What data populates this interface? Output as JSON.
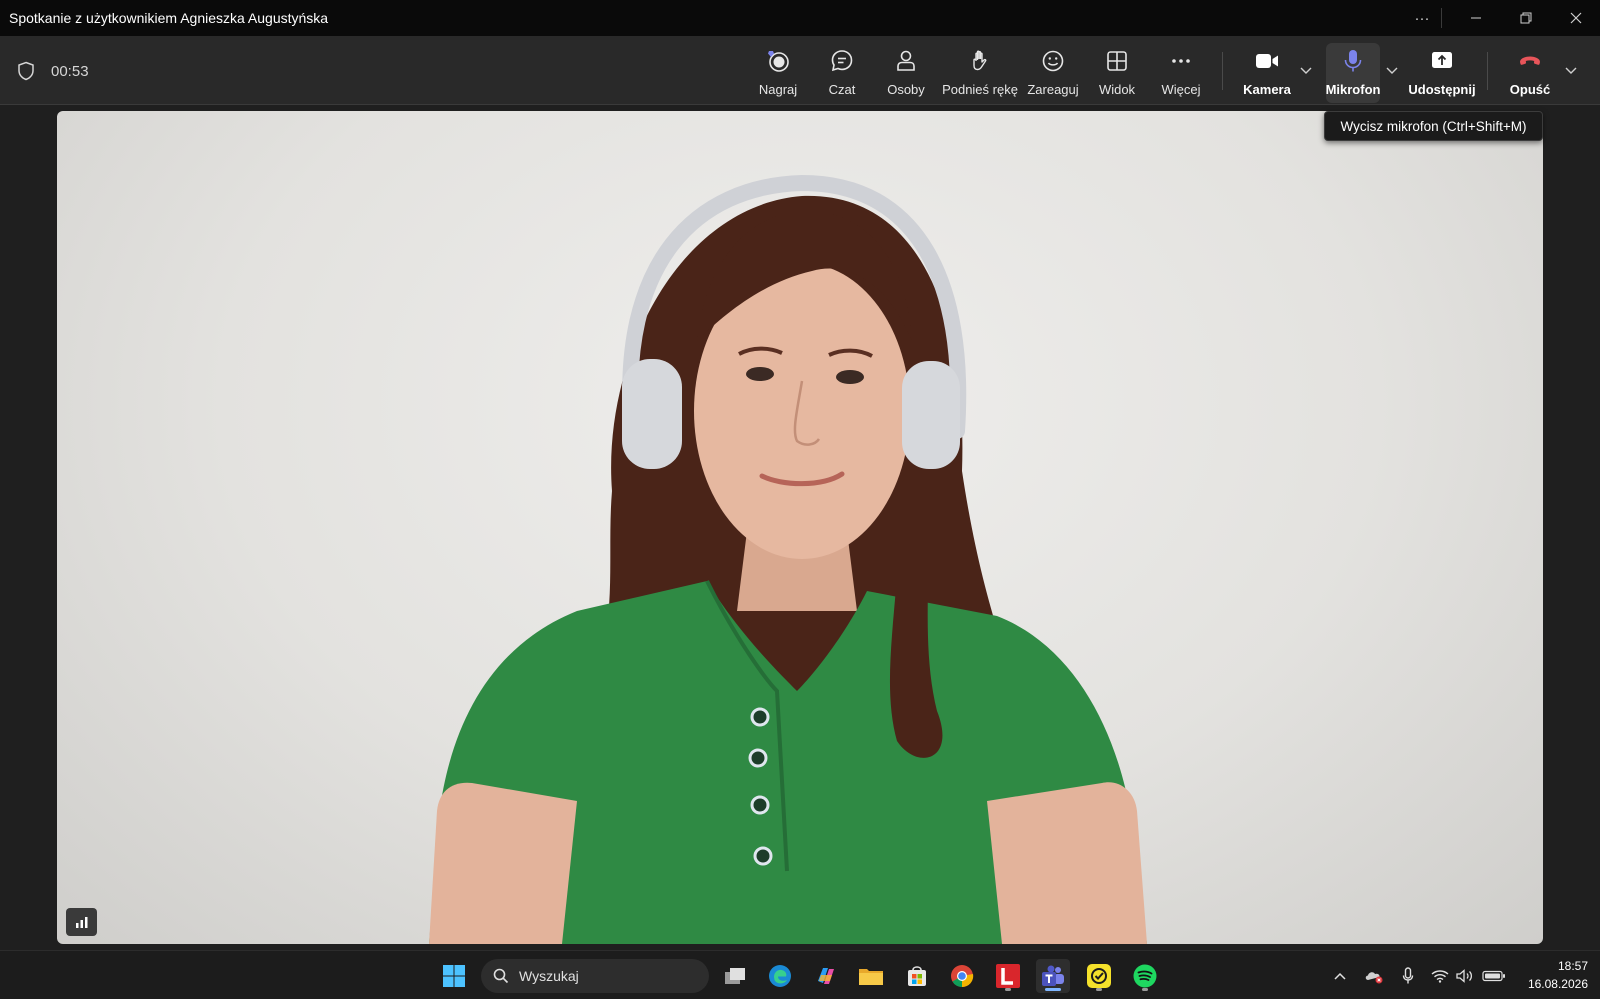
{
  "window": {
    "title": "Spotkanie z użytkownikiem Agnieszka Augustyńska"
  },
  "meeting": {
    "elapsed": "00:53"
  },
  "toolbar": {
    "record": "Nagraj",
    "chat": "Czat",
    "people": "Osoby",
    "raise_hand": "Podnieś rękę",
    "react": "Zareaguj",
    "view": "Widok",
    "more": "Więcej",
    "camera": "Kamera",
    "mic": "Mikrofon",
    "share": "Udostępnij",
    "leave": "Opuść"
  },
  "tooltip": {
    "mic": "Wycisz mikrofon (Ctrl+Shift+M)"
  },
  "taskbar": {
    "search_placeholder": "Wyszukaj",
    "time": "18:57",
    "date": "16.08.2026"
  },
  "colors": {
    "accent": "#7b83eb",
    "leave_red": "#e8555a",
    "shirt_green": "#2f8a44"
  }
}
